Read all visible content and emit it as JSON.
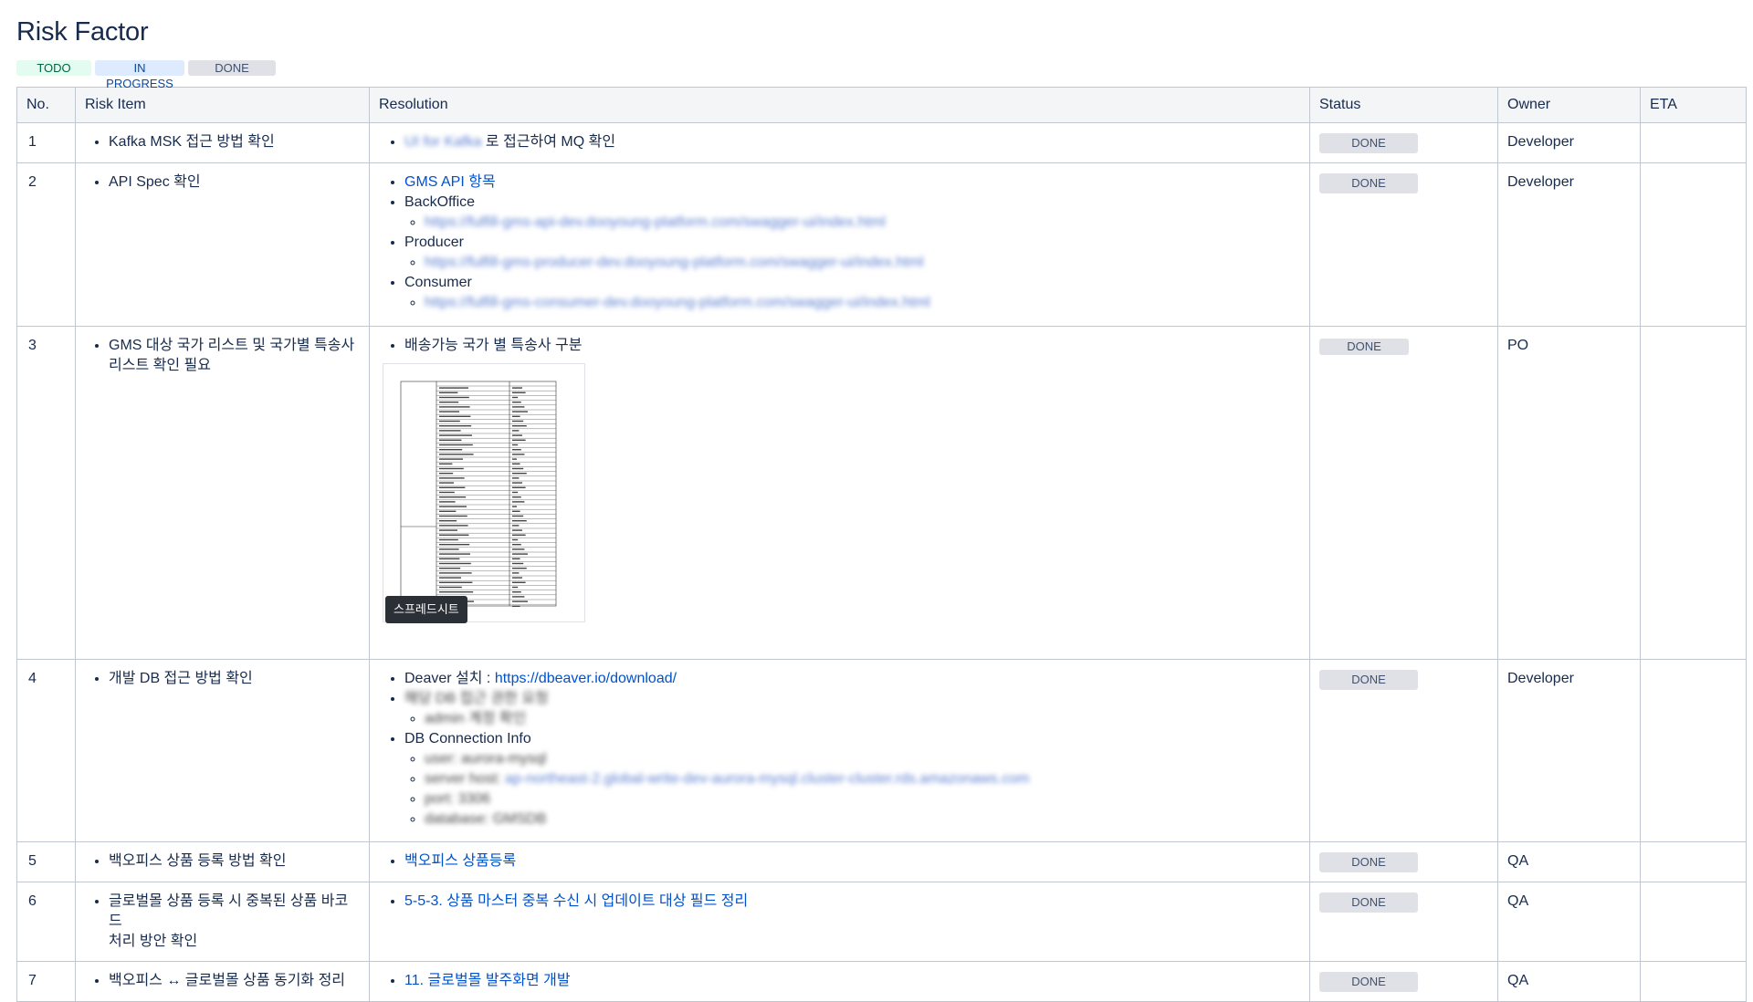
{
  "page": {
    "title": "Risk Factor"
  },
  "legend": {
    "todo": "TODO",
    "in_progress": "IN PROGRESS",
    "done": "DONE"
  },
  "table": {
    "headers": [
      "No.",
      "Risk Item",
      "Resolution",
      "Status",
      "Owner",
      "ETA"
    ],
    "rows": [
      {
        "no": "1",
        "risk": [
          "Kafka MSK 접근 방법 확인"
        ],
        "res1_blur": "UI for Kafka",
        "res1_text": " 로 접근하여 MQ 확인",
        "status": "DONE",
        "owner": "Developer",
        "eta": ""
      },
      {
        "no": "2",
        "risk": [
          "API Spec 확인"
        ],
        "res_link": "GMS API 항목",
        "backoffice": " BackOffice",
        "backoffice_url": "https://fulfill-gms-api-dev.dooyoung-platform.com/swagger-ui/index.html",
        "producer": "Producer",
        "producer_url": "https://fulfill-gms-producer-dev.dooyoung-platform.com/swagger-ui/index.html",
        "consumer": "Consumer",
        "consumer_url": "https://fulfill-gms-consumer-dev.dooyoung-platform.com/swagger-ui/index.html",
        "status": "DONE",
        "owner": "Developer",
        "eta": ""
      },
      {
        "no": "3",
        "risk": [
          "GMS 대상 국가 리스트 및 국가별 특송사",
          "리스트 확인 필요"
        ],
        "res_text": "배송가능 국가  별 특송사 구분",
        "thumb_tooltip": "스프레드시트",
        "status": "DONE",
        "owner": "PO",
        "eta": ""
      },
      {
        "no": "4",
        "risk": [
          "개발 DB 접근 방법 확인"
        ],
        "deaver_label": "Deaver 설치 : ",
        "deaver_link": "https://dbeaver.io/download/",
        "blur_a": "해당 DB 접근 권한 요청",
        "blur_a_sub": "admin 계정 확인",
        "dbconn": "DB Connection Info",
        "blur_b1": "user: aurora-mysql",
        "blur_b2_label": "server host: ",
        "blur_b2_link": "ap-northeast-2.global-write-dev-aurora-mysql.cluster-cluster.rds.amazonaws.com",
        "blur_b3": "port: 3306",
        "blur_b4": "database: GMSDB",
        "status": "DONE",
        "owner": "Developer",
        "eta": ""
      },
      {
        "no": "5",
        "risk": [
          "백오피스 상품 등록 방법 확인"
        ],
        "res_link": "백오피스 상품등록",
        "status": "DONE",
        "owner": "QA",
        "eta": ""
      },
      {
        "no": "6",
        "risk": [
          "글로벌몰 상품 등록 시 중복된 상품 바코드",
          "처리 방안 확인"
        ],
        "res_link": "5-5-3. 상품 마스터 중복 수신 시 업데이트 대상 필드 정리",
        "status": "DONE",
        "owner": "QA",
        "eta": ""
      },
      {
        "no": "7",
        "risk": [
          "백오피스 ↔ 글로벌몰 상품 동기화 정리"
        ],
        "res_link": "11. 글로벌몰 발주화면 개발",
        "status": "DONE",
        "owner": "QA",
        "eta": ""
      }
    ]
  },
  "colors": {
    "link": "#0052cc",
    "done_bg": "#dfe1e6",
    "todo_bg": "#e3fcef",
    "progress_bg": "#deebff"
  },
  "icons": {
    "thumbnail": "spreadsheet-thumbnail-icon"
  }
}
